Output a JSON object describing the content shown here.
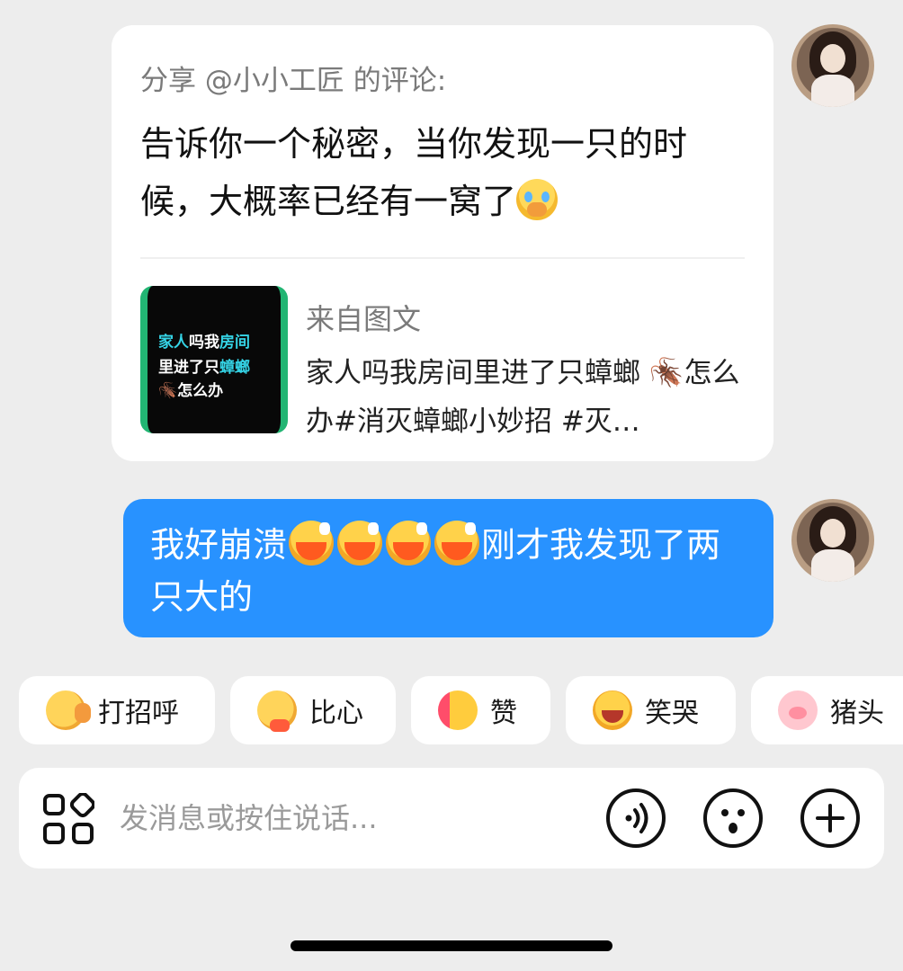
{
  "share_card": {
    "header": "分享 @小小工匠 的评论:",
    "text": "告诉你一个秘密，当你发现一只的时候，大概率已经有一窝了",
    "source_label": "来自图文",
    "source_desc": "家人吗我房间里进了只蟑螂 🪳怎么办#消灭蟑螂小妙招 #灭…",
    "thumbnail": {
      "line1_a": "家人",
      "line1_b": "吗我",
      "line1_c": "房间",
      "line2_a": "里进了只",
      "line2_b": "蟑螂",
      "line3": "🪳怎么办"
    }
  },
  "message": {
    "part1": "我好崩溃",
    "part2": "刚才我发现了两只大的"
  },
  "quick_replies": [
    {
      "label": "打招呼",
      "icon": "wave-emoji-icon"
    },
    {
      "label": "比心",
      "icon": "finger-heart-emoji-icon"
    },
    {
      "label": "赞",
      "icon": "thumbs-up-emoji-icon"
    },
    {
      "label": "笑哭",
      "icon": "laugh-cry-emoji-icon"
    },
    {
      "label": "猪头",
      "icon": "pig-head-emoji-icon"
    }
  ],
  "input": {
    "placeholder": "发消息或按住说话..."
  },
  "colors": {
    "background": "#ededed",
    "bubble_blue": "#2892ff",
    "card": "#ffffff"
  }
}
